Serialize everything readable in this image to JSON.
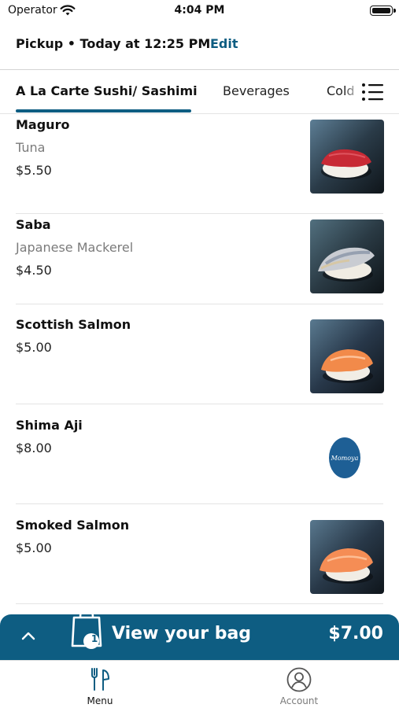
{
  "status_bar": {
    "carrier": "Operator",
    "time": "4:04 PM"
  },
  "order": {
    "pickup_info": "Pickup • Today at 12:25 PM",
    "edit_label": "Edit"
  },
  "categories": {
    "tabs": [
      {
        "label": "A La Carte Sushi/ Sashimi",
        "active": true
      },
      {
        "label": "Beverages",
        "active": false
      },
      {
        "label": "Cold",
        "active": false
      }
    ]
  },
  "menu_items": [
    {
      "name": "Maguro",
      "description": "Tuna",
      "price": "$5.50",
      "image": "tuna-nigiri-photo"
    },
    {
      "name": "Saba",
      "description": "Japanese Mackerel",
      "price": "$4.50",
      "image": "mackerel-nigiri-photo"
    },
    {
      "name": "Scottish Salmon",
      "description": "",
      "price": "$5.00",
      "image": "salmon-nigiri-photo"
    },
    {
      "name": "Shima Aji",
      "description": "",
      "price": "$8.00",
      "image": "restaurant-logo",
      "logo_text": "Momoya"
    },
    {
      "name": "Smoked Salmon",
      "description": "",
      "price": "$5.00",
      "image": "smoked-salmon-nigiri-photo"
    }
  ],
  "bag": {
    "label": "View your bag",
    "count": "1",
    "total": "$7.00"
  },
  "tab_bar": {
    "items": [
      {
        "label": "Menu",
        "icon": "fork-knife-icon",
        "active": true
      },
      {
        "label": "Account",
        "icon": "user-circle-icon",
        "active": false
      }
    ]
  },
  "colors": {
    "accent": "#0e5d82",
    "muted_text": "#7b7b7b",
    "logo_badge": "#1e5f95"
  }
}
